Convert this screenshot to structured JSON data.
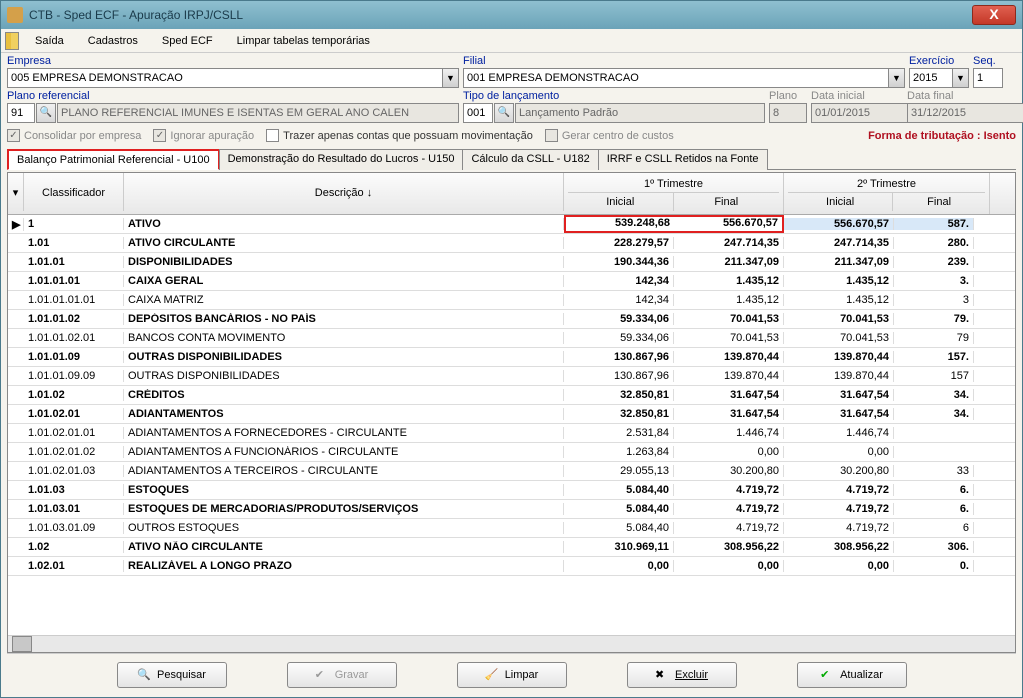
{
  "window": {
    "title": "CTB - Sped ECF - Apuração IRPJ/CSLL"
  },
  "menu": {
    "saida": "Saída",
    "cadastros": "Cadastros",
    "sped": "Sped ECF",
    "limpar": "Limpar tabelas temporárias"
  },
  "labels": {
    "empresa": "Empresa",
    "filial": "Filial",
    "exercicio": "Exercício",
    "seq": "Seq.",
    "plano_ref": "Plano referencial",
    "tipo_lanc": "Tipo de lançamento",
    "plano": "Plano",
    "data_ini": "Data inicial",
    "data_fim": "Data final"
  },
  "fields": {
    "empresa": "005 EMPRESA DEMONSTRACAO",
    "filial": "001 EMPRESA DEMONSTRACAO",
    "exercicio": "2015",
    "seq": "1",
    "plano_ref_cod": "91",
    "plano_ref_desc": "PLANO REFERENCIAL IMUNES E ISENTAS EM GERAL ANO CALEN",
    "tipo_lanc_cod": "001",
    "tipo_lanc_desc": "Lançamento Padrão",
    "plano": "8",
    "data_ini": "01/01/2015",
    "data_fim": "31/12/2015"
  },
  "checks": {
    "consolidar": "Consolidar por empresa",
    "ignorar": "Ignorar apuração",
    "trazer": "Trazer apenas contas que possuam movimentação",
    "gerar": "Gerar centro de custos"
  },
  "tributacao": "Forma de tributação : Isento",
  "tabs": {
    "t1": "Balanço Patrimonial Referencial - U100",
    "t2": "Demonstração do Resultado do Lucros - U150",
    "t3": "Cálculo da CSLL - U182",
    "t4": "IRRF e CSLL Retidos na Fonte"
  },
  "grid_headers": {
    "classificador": "Classificador",
    "descricao": "Descrição  ↓",
    "t1": "1º Trimestre",
    "t2": "2º Trimestre",
    "inicial": "Inicial",
    "final": "Final"
  },
  "rows": [
    {
      "b": true,
      "sel": true,
      "c": "1",
      "d": "ATIVO",
      "t1i": "539.248,68",
      "t1f": "556.670,57",
      "t2i": "556.670,57",
      "t2f": "587.",
      "hl": "red"
    },
    {
      "b": true,
      "c": "1.01",
      "d": "ATIVO CIRCULANTE",
      "t1i": "228.279,57",
      "t1f": "247.714,35",
      "t2i": "247.714,35",
      "t2f": "280."
    },
    {
      "b": true,
      "c": "1.01.01",
      "d": "DISPONIBILIDADES",
      "t1i": "190.344,36",
      "t1f": "211.347,09",
      "t2i": "211.347,09",
      "t2f": "239."
    },
    {
      "b": true,
      "c": "1.01.01.01",
      "d": "CAIXA GERAL",
      "t1i": "142,34",
      "t1f": "1.435,12",
      "t2i": "1.435,12",
      "t2f": "3."
    },
    {
      "c": "1.01.01.01.01",
      "d": "CAIXA MATRIZ",
      "t1i": "142,34",
      "t1f": "1.435,12",
      "t2i": "1.435,12",
      "t2f": "3"
    },
    {
      "b": true,
      "c": "1.01.01.02",
      "d": "DEPÓSITOS BANCÁRIOS - NO PAÍS",
      "t1i": "59.334,06",
      "t1f": "70.041,53",
      "t2i": "70.041,53",
      "t2f": "79."
    },
    {
      "c": "1.01.01.02.01",
      "d": "BANCOS CONTA MOVIMENTO",
      "t1i": "59.334,06",
      "t1f": "70.041,53",
      "t2i": "70.041,53",
      "t2f": "79"
    },
    {
      "b": true,
      "c": "1.01.01.09",
      "d": "OUTRAS DISPONIBILIDADES",
      "t1i": "130.867,96",
      "t1f": "139.870,44",
      "t2i": "139.870,44",
      "t2f": "157."
    },
    {
      "c": "1.01.01.09.09",
      "d": "OUTRAS DISPONIBILIDADES",
      "t1i": "130.867,96",
      "t1f": "139.870,44",
      "t2i": "139.870,44",
      "t2f": "157"
    },
    {
      "b": true,
      "c": "1.01.02",
      "d": "CRÉDITOS",
      "t1i": "32.850,81",
      "t1f": "31.647,54",
      "t2i": "31.647,54",
      "t2f": "34."
    },
    {
      "b": true,
      "c": "1.01.02.01",
      "d": "ADIANTAMENTOS",
      "t1i": "32.850,81",
      "t1f": "31.647,54",
      "t2i": "31.647,54",
      "t2f": "34."
    },
    {
      "c": "1.01.02.01.01",
      "d": "ADIANTAMENTOS A FORNECEDORES - CIRCULANTE",
      "t1i": "2.531,84",
      "t1f": "1.446,74",
      "t2i": "1.446,74",
      "t2f": ""
    },
    {
      "c": "1.01.02.01.02",
      "d": "ADIANTAMENTOS A FUNCIONÁRIOS - CIRCULANTE",
      "t1i": "1.263,84",
      "t1f": "0,00",
      "t2i": "0,00",
      "t2f": ""
    },
    {
      "c": "1.01.02.01.03",
      "d": "ADIANTAMENTOS A TERCEIROS - CIRCULANTE",
      "t1i": "29.055,13",
      "t1f": "30.200,80",
      "t2i": "30.200,80",
      "t2f": "33"
    },
    {
      "b": true,
      "c": "1.01.03",
      "d": "ESTOQUES",
      "t1i": "5.084,40",
      "t1f": "4.719,72",
      "t2i": "4.719,72",
      "t2f": "6."
    },
    {
      "b": true,
      "c": "1.01.03.01",
      "d": "ESTOQUES DE MERCADORIAS/PRODUTOS/SERVIÇOS",
      "t1i": "5.084,40",
      "t1f": "4.719,72",
      "t2i": "4.719,72",
      "t2f": "6."
    },
    {
      "c": "1.01.03.01.09",
      "d": "OUTROS ESTOQUES",
      "t1i": "5.084,40",
      "t1f": "4.719,72",
      "t2i": "4.719,72",
      "t2f": "6"
    },
    {
      "b": true,
      "c": "1.02",
      "d": "ATIVO NÃO CIRCULANTE",
      "t1i": "310.969,11",
      "t1f": "308.956,22",
      "t2i": "308.956,22",
      "t2f": "306."
    },
    {
      "b": true,
      "c": "1.02.01",
      "d": "REALIZÁVEL A LONGO PRAZO",
      "t1i": "0,00",
      "t1f": "0,00",
      "t2i": "0,00",
      "t2f": "0."
    }
  ],
  "buttons": {
    "pesquisar": "Pesquisar",
    "gravar": "Gravar",
    "limpar": "Limpar",
    "excluir": "Excluir",
    "atualizar": "Atualizar"
  }
}
